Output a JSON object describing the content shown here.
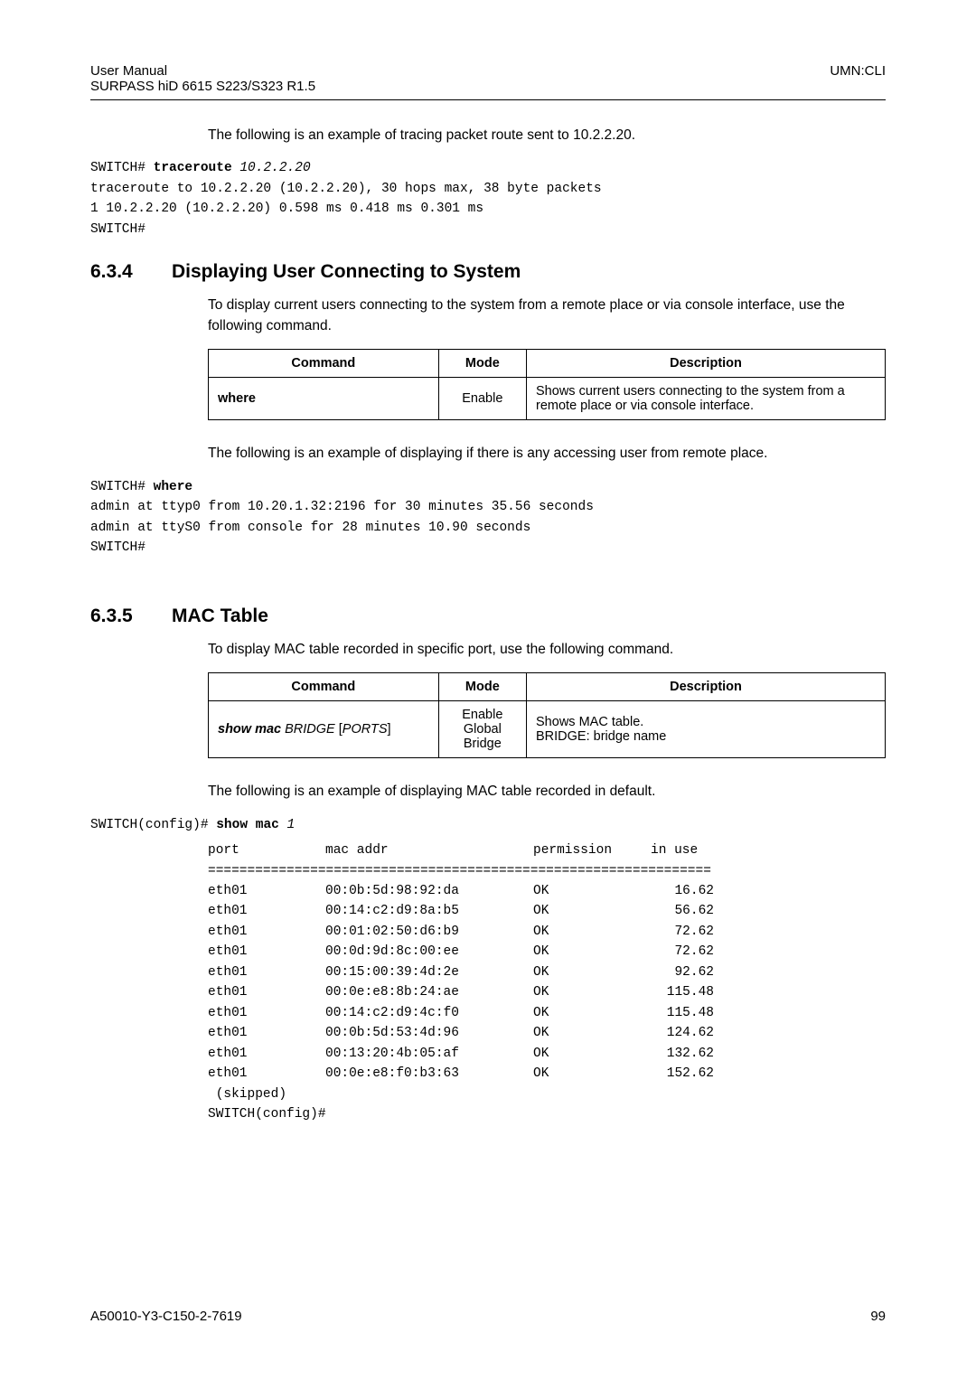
{
  "header": {
    "left_line1": "User Manual",
    "left_line2": "SURPASS hiD 6615 S223/S323 R1.5",
    "right": "UMN:CLI"
  },
  "intro1": "The following is an example of tracing packet route sent to 10.2.2.20.",
  "code1": {
    "prompt": "SWITCH# ",
    "cmd": "traceroute",
    "arg": " 10.2.2.20",
    "l2": "traceroute to 10.2.2.20 (10.2.2.20), 30 hops max, 38 byte packets",
    "l3": "1 10.2.2.20 (10.2.2.20) 0.598 ms 0.418 ms 0.301 ms",
    "l4": "SWITCH#"
  },
  "sec634": {
    "num": "6.3.4",
    "title": "Displaying User Connecting to System",
    "para": "To display current users connecting to the system from a remote place or via console interface, use the following command.",
    "th1": "Command",
    "th2": "Mode",
    "th3": "Description",
    "cmd": "where",
    "mode": "Enable",
    "desc": "Shows current users connecting to the system from a remote place or via console interface.",
    "after": "The following is an example of displaying if there is any accessing user from remote place."
  },
  "code2": {
    "l1a": "SWITCH# ",
    "l1b": "where",
    "l2": "admin at ttyp0 from 10.20.1.32:2196 for 30 minutes 35.56 seconds",
    "l3": "admin at ttyS0 from console for 28 minutes 10.90 seconds",
    "l4": "SWITCH#"
  },
  "sec635": {
    "num": "6.3.5",
    "title": "MAC Table",
    "para": "To display MAC table recorded in specific port, use the following command.",
    "th1": "Command",
    "th2": "Mode",
    "th3": "Description",
    "cmd_b": "show mac ",
    "cmd_i1": "BRIDGE ",
    "cmd_lb": "[",
    "cmd_i2": "PORTS",
    "cmd_rb": "]",
    "mode1": "Enable",
    "mode2": "Global",
    "mode3": "Bridge",
    "desc1": "Shows MAC table.",
    "desc2": "BRIDGE: bridge name",
    "after": "The following is an example of displaying MAC table recorded in default."
  },
  "code3": {
    "l1a": "SWITCH(config)# ",
    "l1b": "show mac",
    "l1c": " 1",
    "hdr_port": "port",
    "hdr_mac": "mac addr",
    "hdr_perm": "permission",
    "hdr_use": "in use",
    "sep": "================================================================",
    "skipped": " (skipped)",
    "end": "SWITCH(config)#"
  },
  "chart_data": {
    "type": "table",
    "columns": [
      "port",
      "mac addr",
      "permission",
      "in use"
    ],
    "rows": [
      [
        "eth01",
        "00:0b:5d:98:92:da",
        "OK",
        "16.62"
      ],
      [
        "eth01",
        "00:14:c2:d9:8a:b5",
        "OK",
        "56.62"
      ],
      [
        "eth01",
        "00:01:02:50:d6:b9",
        "OK",
        "72.62"
      ],
      [
        "eth01",
        "00:0d:9d:8c:00:ee",
        "OK",
        "72.62"
      ],
      [
        "eth01",
        "00:15:00:39:4d:2e",
        "OK",
        "92.62"
      ],
      [
        "eth01",
        "00:0e:e8:8b:24:ae",
        "OK",
        "115.48"
      ],
      [
        "eth01",
        "00:14:c2:d9:4c:f0",
        "OK",
        "115.48"
      ],
      [
        "eth01",
        "00:0b:5d:53:4d:96",
        "OK",
        "124.62"
      ],
      [
        "eth01",
        "00:13:20:4b:05:af",
        "OK",
        "132.62"
      ],
      [
        "eth01",
        "00:0e:e8:f0:b3:63",
        "OK",
        "152.62"
      ]
    ]
  },
  "footer": {
    "left": "A50010-Y3-C150-2-7619",
    "right": "99"
  }
}
